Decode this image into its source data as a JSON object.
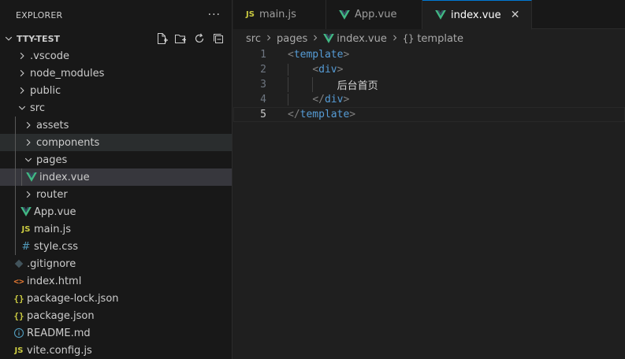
{
  "explorer": {
    "title": "EXPLORER",
    "more_glyph": "···",
    "project_name": "TTY-TEST",
    "actions": [
      "new-file-icon",
      "new-folder-icon",
      "refresh-icon",
      "collapse-all-icon"
    ],
    "tree": [
      {
        "label": ".vscode",
        "type": "folder",
        "expanded": false,
        "depth": 1
      },
      {
        "label": "node_modules",
        "type": "folder",
        "expanded": false,
        "depth": 1
      },
      {
        "label": "public",
        "type": "folder",
        "expanded": false,
        "depth": 1
      },
      {
        "label": "src",
        "type": "folder",
        "expanded": true,
        "depth": 1
      },
      {
        "label": "assets",
        "type": "folder",
        "expanded": false,
        "depth": 2
      },
      {
        "label": "components",
        "type": "folder",
        "expanded": false,
        "depth": 2,
        "state": "hover"
      },
      {
        "label": "pages",
        "type": "folder",
        "expanded": true,
        "depth": 2
      },
      {
        "label": "index.vue",
        "type": "vue",
        "depth": 3,
        "state": "selected"
      },
      {
        "label": "router",
        "type": "folder",
        "expanded": false,
        "depth": 2
      },
      {
        "label": "App.vue",
        "type": "vue",
        "depth": 2
      },
      {
        "label": "main.js",
        "type": "js",
        "depth": 2
      },
      {
        "label": "style.css",
        "type": "css",
        "depth": 2
      },
      {
        "label": ".gitignore",
        "type": "git",
        "depth": 1
      },
      {
        "label": "index.html",
        "type": "html",
        "depth": 1
      },
      {
        "label": "package-lock.json",
        "type": "json",
        "depth": 1
      },
      {
        "label": "package.json",
        "type": "json",
        "depth": 1
      },
      {
        "label": "README.md",
        "type": "md",
        "depth": 1
      },
      {
        "label": "vite.config.js",
        "type": "js",
        "depth": 1
      }
    ]
  },
  "tabs": [
    {
      "label": "main.js",
      "icon": "js",
      "active": false
    },
    {
      "label": "App.vue",
      "icon": "vue",
      "active": false
    },
    {
      "label": "index.vue",
      "icon": "vue",
      "active": true,
      "close": "✕"
    }
  ],
  "breadcrumb": {
    "parts": [
      "src",
      "pages",
      "index.vue",
      "template"
    ],
    "braces": "{}"
  },
  "code": {
    "active_line": 5,
    "lines": [
      {
        "num": "1",
        "tokens": [
          [
            "brk",
            "<"
          ],
          [
            "tag",
            "template"
          ],
          [
            "brk",
            ">"
          ]
        ],
        "indent": 0
      },
      {
        "num": "2",
        "tokens": [
          [
            "brk",
            "<"
          ],
          [
            "tag",
            "div"
          ],
          [
            "brk",
            ">"
          ]
        ],
        "indent": 1
      },
      {
        "num": "3",
        "tokens": [
          [
            "txt",
            "后台首页"
          ]
        ],
        "indent": 2
      },
      {
        "num": "4",
        "tokens": [
          [
            "brk",
            "</"
          ],
          [
            "tag",
            "div"
          ],
          [
            "brk",
            ">"
          ]
        ],
        "indent": 1
      },
      {
        "num": "5",
        "tokens": [
          [
            "brk",
            "</"
          ],
          [
            "tag",
            "template"
          ],
          [
            "brk",
            ">"
          ]
        ],
        "indent": 0
      }
    ]
  },
  "colors": {
    "vue_green": "#41b883",
    "accent": "#0078d4",
    "js_yellow": "#cbcb41"
  }
}
